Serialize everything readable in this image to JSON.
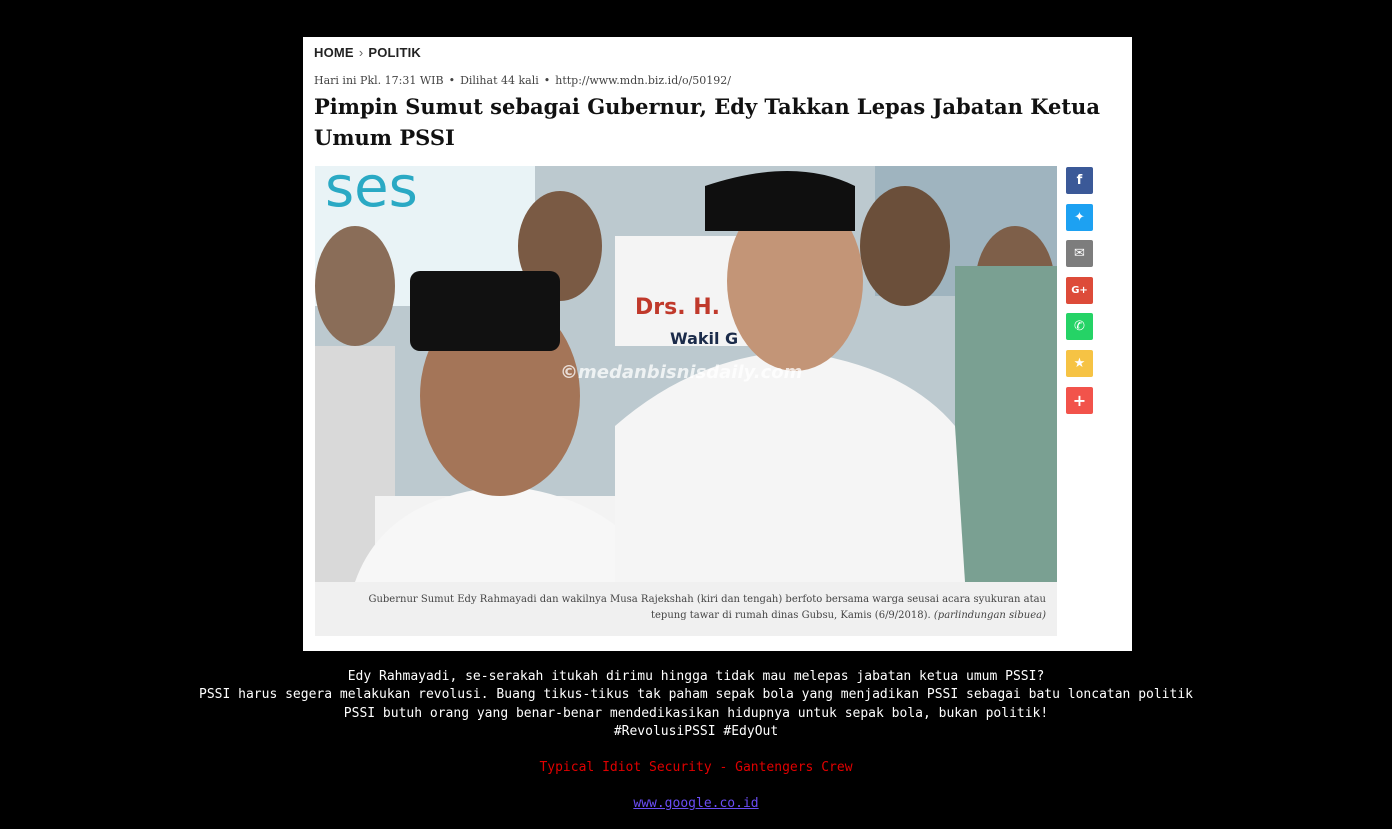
{
  "breadcrumb": {
    "home": "HOME",
    "section": "POLITIK"
  },
  "meta": {
    "time": "Hari ini Pkl. 17:31 WIB",
    "views": "Dilihat 44 kali",
    "short_url": "http://www.mdn.biz.id/o/50192/"
  },
  "article": {
    "title": "Pimpin Sumut sebagai Gubernur, Edy Takkan Lepas Jabatan Ketua Umum PSSI"
  },
  "photo": {
    "watermark": "©medanbisnisdaily.com",
    "banner_text_1": "Drs. H.",
    "banner_text_2": "Wakil G",
    "banner_text_3": "ses"
  },
  "caption": {
    "text": "Gubernur Sumut Edy Rahmayadi dan wakilnya Musa Rajekshah (kiri dan tengah) berfoto bersama warga seusai acara syukuran atau tepung tawar di rumah dinas Gubsu, Kamis (6/9/2018).",
    "credit": "(parlindungan sibuea)"
  },
  "share": [
    {
      "name": "facebook-icon",
      "glyph": "f",
      "color": "#3b5998"
    },
    {
      "name": "twitter-icon",
      "glyph": "✦",
      "color": "#1da1f2"
    },
    {
      "name": "email-icon",
      "glyph": "✉",
      "color": "#7d7d7d"
    },
    {
      "name": "google-plus-icon",
      "glyph": "G+",
      "color": "#dd4b39"
    },
    {
      "name": "whatsapp-icon",
      "glyph": "✆",
      "color": "#25d366"
    },
    {
      "name": "favorite-icon",
      "glyph": "★",
      "color": "#f6c344"
    },
    {
      "name": "more-share-icon",
      "glyph": "+",
      "color": "#f2534b"
    }
  ],
  "message": {
    "line1": "Edy Rahmayadi, se-serakah itukah dirimu hingga tidak mau melepas jabatan ketua umum PSSI?",
    "line2": "PSSI harus segera melakukan revolusi. Buang tikus-tikus tak paham sepak bola yang menjadikan PSSI sebagai batu loncatan politik",
    "line3": "PSSI butuh orang yang benar-benar mendedikasikan hidupnya untuk sepak bola, bukan politik!",
    "line4": "#RevolusiPSSI #EdyOut"
  },
  "credit": "Typical Idiot Security - Gantengers Crew",
  "link": "www.google.co.id",
  "colors": {
    "background": "#000000",
    "credit": "#e00000",
    "link": "#6a4df5"
  }
}
